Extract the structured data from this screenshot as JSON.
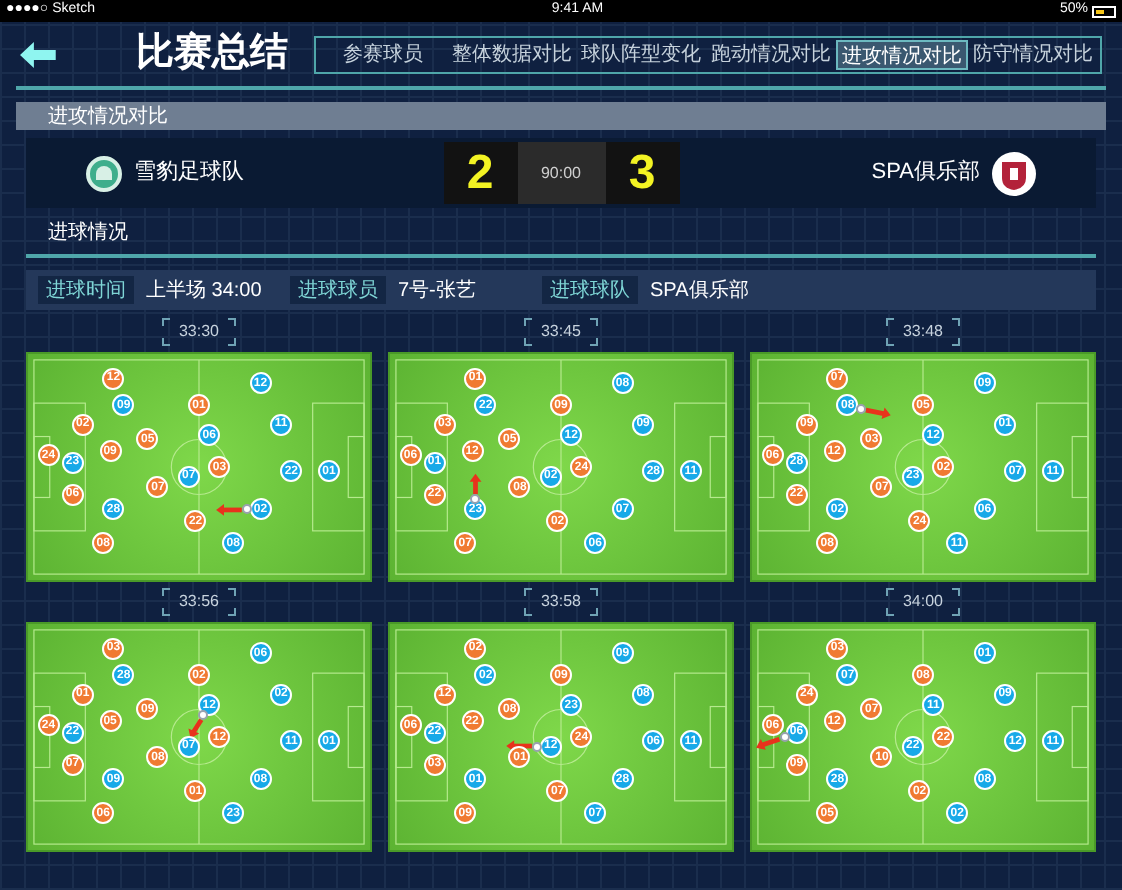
{
  "status_bar": {
    "carrier": "●●●●○ Sketch",
    "time": "9:41 AM",
    "battery": "50%"
  },
  "header": {
    "title": "比赛总结"
  },
  "tabs": [
    {
      "label": "参赛球员",
      "selected": false
    },
    {
      "label": "整体数据对比",
      "selected": false
    },
    {
      "label": "球队阵型变化",
      "selected": false
    },
    {
      "label": "跑动情况对比",
      "selected": false
    },
    {
      "label": "进攻情况对比",
      "selected": true
    },
    {
      "label": "防守情况对比",
      "selected": false
    }
  ],
  "section_title": "进攻情况对比",
  "match": {
    "home_name": "雪豹足球队",
    "home_score": "2",
    "clock": "90:00",
    "away_score": "3",
    "away_name": "SPA俱乐部"
  },
  "goal_section": {
    "title": "进球情况",
    "fields": [
      {
        "label": "进球时间",
        "value": "上半场 34:00"
      },
      {
        "label": "进球球员",
        "value": "7号-张艺"
      },
      {
        "label": "进球球队",
        "value": "SPA俱乐部"
      }
    ]
  },
  "snapshots": [
    {
      "time": "33:30",
      "players": [
        {
          "number": "12",
          "color": "#f07a32"
        },
        {
          "number": "09",
          "color": "#17a9e8"
        },
        {
          "number": "01",
          "color": "#f07a32"
        },
        {
          "number": "12",
          "color": "#17a9e8"
        },
        {
          "number": "02",
          "color": "#f07a32"
        },
        {
          "number": "09",
          "color": "#f07a32"
        },
        {
          "number": "05",
          "color": "#f07a32"
        },
        {
          "number": "06",
          "color": "#17a9e8"
        },
        {
          "number": "11",
          "color": "#17a9e8"
        },
        {
          "number": "24",
          "color": "#f07a32"
        },
        {
          "number": "23",
          "color": "#17a9e8"
        },
        {
          "number": "07",
          "color": "#17a9e8"
        },
        {
          "number": "03",
          "color": "#f07a32"
        },
        {
          "number": "22",
          "color": "#17a9e8"
        },
        {
          "number": "01",
          "color": "#17a9e8"
        },
        {
          "number": "06",
          "color": "#f07a32"
        },
        {
          "number": "07",
          "color": "#f07a32"
        },
        {
          "number": "28",
          "color": "#17a9e8"
        },
        {
          "number": "22",
          "color": "#f07a32"
        },
        {
          "number": "02",
          "color": "#17a9e8"
        },
        {
          "number": "08",
          "color": "#f07a32"
        },
        {
          "number": "08",
          "color": "#17a9e8"
        }
      ]
    },
    {
      "time": "33:45",
      "players": [
        {
          "number": "01",
          "color": "#f07a32"
        },
        {
          "number": "22",
          "color": "#17a9e8"
        },
        {
          "number": "09",
          "color": "#f07a32"
        },
        {
          "number": "08",
          "color": "#17a9e8"
        },
        {
          "number": "03",
          "color": "#f07a32"
        },
        {
          "number": "12",
          "color": "#f07a32"
        },
        {
          "number": "05",
          "color": "#f07a32"
        },
        {
          "number": "12",
          "color": "#17a9e8"
        },
        {
          "number": "09",
          "color": "#17a9e8"
        },
        {
          "number": "06",
          "color": "#f07a32"
        },
        {
          "number": "01",
          "color": "#17a9e8"
        },
        {
          "number": "02",
          "color": "#17a9e8"
        },
        {
          "number": "24",
          "color": "#f07a32"
        },
        {
          "number": "28",
          "color": "#17a9e8"
        },
        {
          "number": "11",
          "color": "#17a9e8"
        },
        {
          "number": "22",
          "color": "#f07a32"
        },
        {
          "number": "08",
          "color": "#f07a32"
        },
        {
          "number": "23",
          "color": "#17a9e8"
        },
        {
          "number": "02",
          "color": "#f07a32"
        },
        {
          "number": "07",
          "color": "#17a9e8"
        },
        {
          "number": "07",
          "color": "#f07a32"
        },
        {
          "number": "06",
          "color": "#17a9e8"
        }
      ]
    },
    {
      "time": "33:48",
      "players": [
        {
          "number": "07",
          "color": "#f07a32"
        },
        {
          "number": "08",
          "color": "#17a9e8"
        },
        {
          "number": "05",
          "color": "#f07a32"
        },
        {
          "number": "09",
          "color": "#17a9e8"
        },
        {
          "number": "09",
          "color": "#f07a32"
        },
        {
          "number": "12",
          "color": "#f07a32"
        },
        {
          "number": "03",
          "color": "#f07a32"
        },
        {
          "number": "12",
          "color": "#17a9e8"
        },
        {
          "number": "01",
          "color": "#17a9e8"
        },
        {
          "number": "06",
          "color": "#f07a32"
        },
        {
          "number": "28",
          "color": "#17a9e8"
        },
        {
          "number": "23",
          "color": "#17a9e8"
        },
        {
          "number": "02",
          "color": "#f07a32"
        },
        {
          "number": "07",
          "color": "#17a9e8"
        },
        {
          "number": "11",
          "color": "#17a9e8"
        },
        {
          "number": "22",
          "color": "#f07a32"
        },
        {
          "number": "07",
          "color": "#f07a32"
        },
        {
          "number": "02",
          "color": "#17a9e8"
        },
        {
          "number": "24",
          "color": "#f07a32"
        },
        {
          "number": "06",
          "color": "#17a9e8"
        },
        {
          "number": "08",
          "color": "#f07a32"
        },
        {
          "number": "11",
          "color": "#17a9e8"
        }
      ]
    },
    {
      "time": "33:56",
      "players": [
        {
          "number": "03",
          "color": "#f07a32"
        },
        {
          "number": "28",
          "color": "#17a9e8"
        },
        {
          "number": "02",
          "color": "#f07a32"
        },
        {
          "number": "06",
          "color": "#17a9e8"
        },
        {
          "number": "01",
          "color": "#f07a32"
        },
        {
          "number": "05",
          "color": "#f07a32"
        },
        {
          "number": "09",
          "color": "#f07a32"
        },
        {
          "number": "12",
          "color": "#17a9e8"
        },
        {
          "number": "02",
          "color": "#17a9e8"
        },
        {
          "number": "24",
          "color": "#f07a32"
        },
        {
          "number": "22",
          "color": "#17a9e8"
        },
        {
          "number": "07",
          "color": "#17a9e8"
        },
        {
          "number": "12",
          "color": "#f07a32"
        },
        {
          "number": "11",
          "color": "#17a9e8"
        },
        {
          "number": "01",
          "color": "#17a9e8"
        },
        {
          "number": "07",
          "color": "#f07a32"
        },
        {
          "number": "08",
          "color": "#f07a32"
        },
        {
          "number": "09",
          "color": "#17a9e8"
        },
        {
          "number": "01",
          "color": "#f07a32"
        },
        {
          "number": "08",
          "color": "#17a9e8"
        },
        {
          "number": "06",
          "color": "#f07a32"
        },
        {
          "number": "23",
          "color": "#17a9e8"
        }
      ]
    },
    {
      "time": "33:58",
      "players": [
        {
          "number": "02",
          "color": "#f07a32"
        },
        {
          "number": "02",
          "color": "#17a9e8"
        },
        {
          "number": "09",
          "color": "#f07a32"
        },
        {
          "number": "09",
          "color": "#17a9e8"
        },
        {
          "number": "12",
          "color": "#f07a32"
        },
        {
          "number": "22",
          "color": "#f07a32"
        },
        {
          "number": "08",
          "color": "#f07a32"
        },
        {
          "number": "23",
          "color": "#17a9e8"
        },
        {
          "number": "08",
          "color": "#17a9e8"
        },
        {
          "number": "06",
          "color": "#f07a32"
        },
        {
          "number": "22",
          "color": "#17a9e8"
        },
        {
          "number": "12",
          "color": "#17a9e8"
        },
        {
          "number": "24",
          "color": "#f07a32"
        },
        {
          "number": "06",
          "color": "#17a9e8"
        },
        {
          "number": "11",
          "color": "#17a9e8"
        },
        {
          "number": "03",
          "color": "#f07a32"
        },
        {
          "number": "01",
          "color": "#f07a32"
        },
        {
          "number": "01",
          "color": "#17a9e8"
        },
        {
          "number": "07",
          "color": "#f07a32"
        },
        {
          "number": "28",
          "color": "#17a9e8"
        },
        {
          "number": "09",
          "color": "#f07a32"
        },
        {
          "number": "07",
          "color": "#17a9e8"
        }
      ]
    },
    {
      "time": "34:00",
      "players": [
        {
          "number": "03",
          "color": "#f07a32"
        },
        {
          "number": "07",
          "color": "#17a9e8"
        },
        {
          "number": "08",
          "color": "#f07a32"
        },
        {
          "number": "01",
          "color": "#17a9e8"
        },
        {
          "number": "24",
          "color": "#f07a32"
        },
        {
          "number": "12",
          "color": "#f07a32"
        },
        {
          "number": "07",
          "color": "#f07a32"
        },
        {
          "number": "11",
          "color": "#17a9e8"
        },
        {
          "number": "09",
          "color": "#17a9e8"
        },
        {
          "number": "06",
          "color": "#f07a32"
        },
        {
          "number": "06",
          "color": "#17a9e8"
        },
        {
          "number": "22",
          "color": "#17a9e8"
        },
        {
          "number": "22",
          "color": "#f07a32"
        },
        {
          "number": "12",
          "color": "#17a9e8"
        },
        {
          "number": "11",
          "color": "#17a9e8"
        },
        {
          "number": "09",
          "color": "#f07a32"
        },
        {
          "number": "10",
          "color": "#f07a32"
        },
        {
          "number": "28",
          "color": "#17a9e8"
        },
        {
          "number": "02",
          "color": "#f07a32"
        },
        {
          "number": "08",
          "color": "#17a9e8"
        },
        {
          "number": "05",
          "color": "#f07a32"
        },
        {
          "number": "02",
          "color": "#17a9e8"
        }
      ]
    }
  ]
}
